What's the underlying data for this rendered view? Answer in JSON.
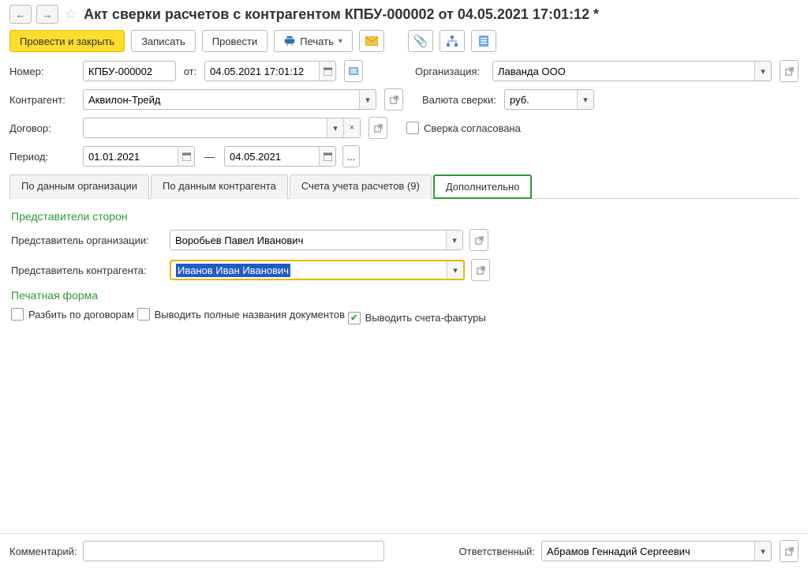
{
  "header": {
    "title": "Акт сверки расчетов с контрагентом КПБУ-000002 от 04.05.2021 17:01:12 *"
  },
  "toolbar": {
    "post_and_close": "Провести и закрыть",
    "save": "Записать",
    "post": "Провести",
    "print": "Печать"
  },
  "form": {
    "number_label": "Номер:",
    "number_value": "КПБУ-000002",
    "from_label": "от:",
    "date_value": "04.05.2021 17:01:12",
    "org_label": "Организация:",
    "org_value": "Лаванда ООО",
    "counterparty_label": "Контрагент:",
    "counterparty_value": "Аквилон-Трейд",
    "currency_label": "Валюта сверки:",
    "currency_value": "руб.",
    "contract_label": "Договор:",
    "agreed_label": "Сверка согласована",
    "period_label": "Период:",
    "period_from": "01.01.2021",
    "period_dash": "—",
    "period_to": "04.05.2021",
    "period_more": "..."
  },
  "tabs": {
    "t1": "По данным организации",
    "t2": "По данным контрагента",
    "t3": "Счета учета расчетов (9)",
    "t4": "Дополнительно"
  },
  "reps": {
    "section": "Представители сторон",
    "org_rep_label": "Представитель организации:",
    "org_rep_value": "Воробьев Павел Иванович",
    "cp_rep_label": "Представитель контрагента:",
    "cp_rep_value": "Иванов Иван Иванович"
  },
  "print_form": {
    "section": "Печатная форма",
    "split_label": "Разбить по договорам",
    "fullnames_label": "Выводить полные названия документов",
    "invoices_label": "Выводить счета-фактуры"
  },
  "footer": {
    "comment_label": "Комментарий:",
    "responsible_label": "Ответственный:",
    "responsible_value": "Абрамов Геннадий Сергеевич"
  }
}
